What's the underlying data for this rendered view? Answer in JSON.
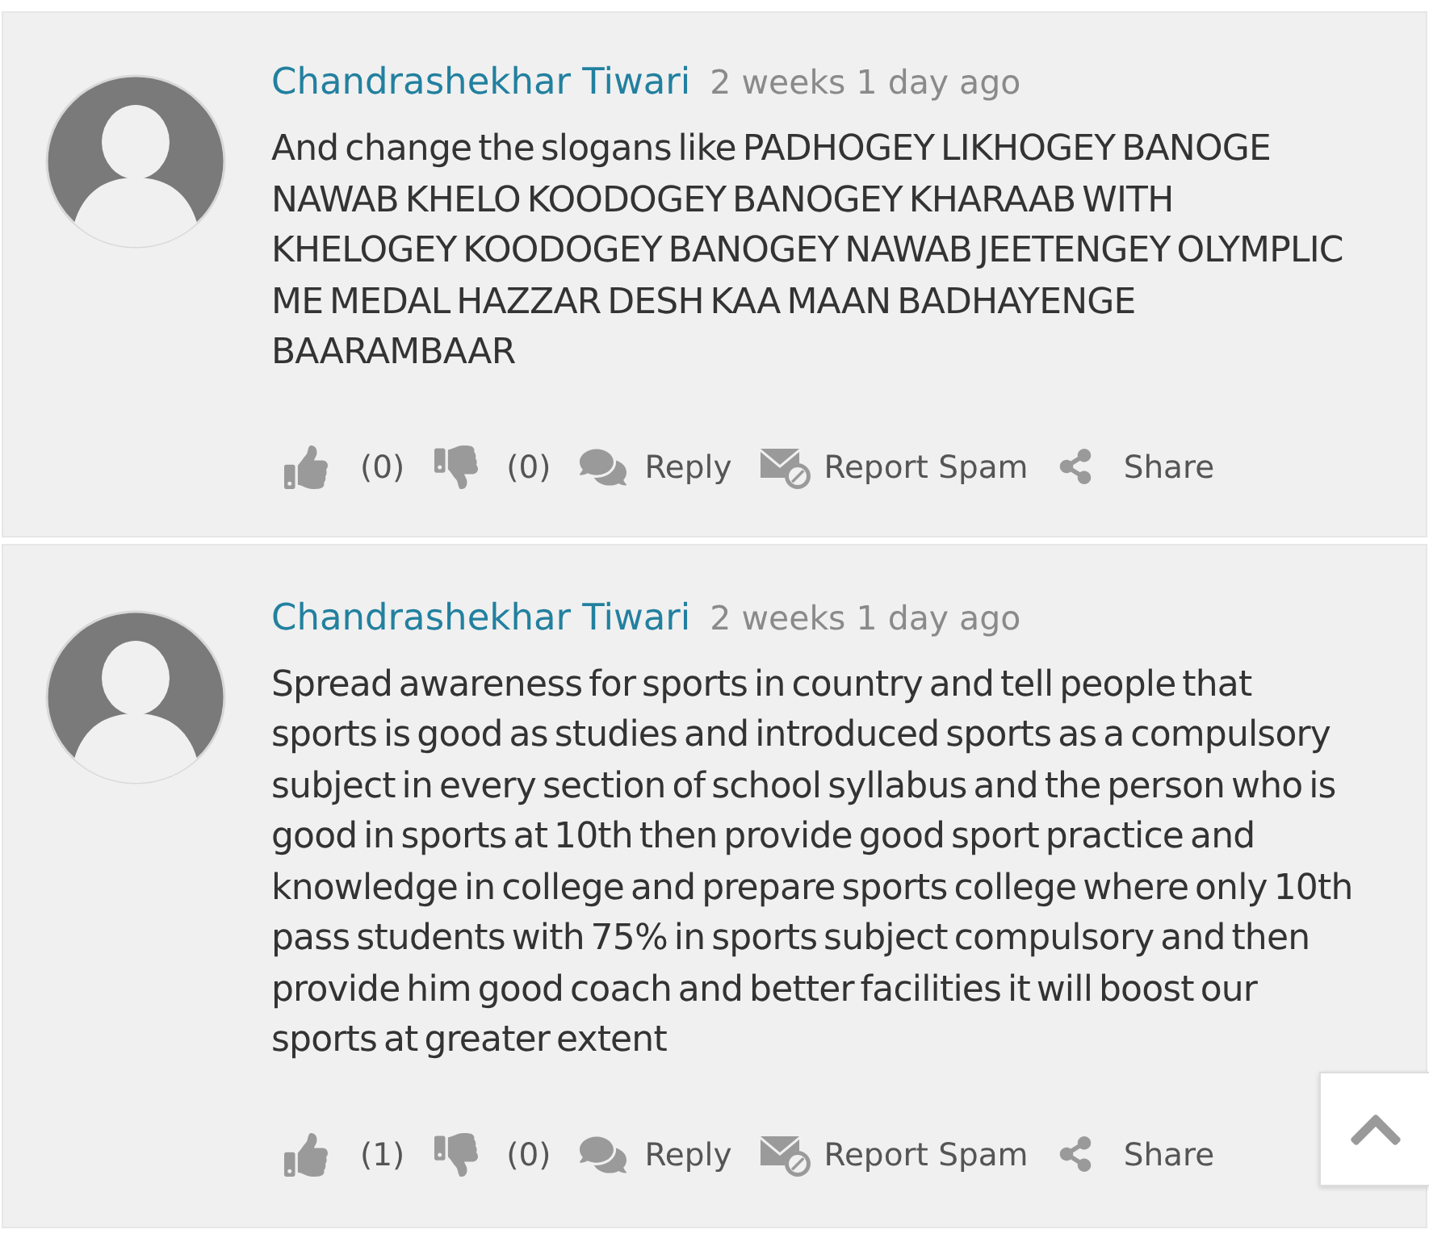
{
  "comments": [
    {
      "author": "Chandrashekhar Tiwari",
      "time": "2 weeks 1 day ago",
      "text": "And change the slogans like PADHOGEY LIKHOGEY BANOGE NAWAB KHELO KOODOGEY BANOGEY KHARAAB WITH KHELOGEY KOODOGEY BANOGEY NAWAB JEETENGEY OLYMPLIC ME MEDAL HAZZAR DESH KAA MAAN BADHAYENGE BAARAMBAAR",
      "actions": [
        {
          "kind": "like",
          "label": "(0)"
        },
        {
          "kind": "dislike",
          "label": "(0)"
        },
        {
          "kind": "reply",
          "label": "Reply"
        },
        {
          "kind": "report",
          "label": "Report Spam"
        },
        {
          "kind": "share",
          "label": "Share"
        }
      ]
    },
    {
      "author": "Chandrashekhar Tiwari",
      "time": "2 weeks 1 day ago",
      "text": "Spread awareness for sports in country and tell people that sports is good as studies and introduced sports as a compulsory subject in every section of school syllabus and the person who is good in sports at 10th then provide good sport practice and knowledge in college and prepare sports college where only 10th pass students with 75% in sports subject compulsory and then provide him good coach and better facilities it will boost our sports at greater extent",
      "actions": [
        {
          "kind": "like",
          "label": "(1)"
        },
        {
          "kind": "dislike",
          "label": "(0)"
        },
        {
          "kind": "reply",
          "label": "Reply"
        },
        {
          "kind": "report",
          "label": "Report Spam"
        },
        {
          "kind": "share",
          "label": "Share"
        }
      ]
    }
  ]
}
